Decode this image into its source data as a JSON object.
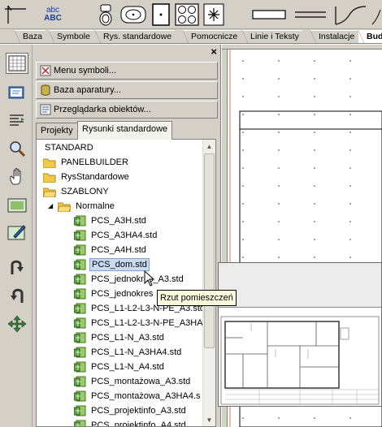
{
  "toolbar": {
    "tools": [
      {
        "icon": "cursor-icon"
      },
      {
        "icon": "text-abc-icon",
        "label_top": "abc",
        "label_bottom": "ABC"
      },
      {
        "icon": "toilet-icon"
      },
      {
        "icon": "sink-icon"
      },
      {
        "icon": "door-symbol-icon"
      },
      {
        "icon": "stove-icon"
      },
      {
        "icon": "asterisk-icon"
      },
      {
        "icon": "rectangle-icon"
      },
      {
        "icon": "parallel-lines-icon"
      },
      {
        "icon": "curve-icon"
      }
    ]
  },
  "tabs": [
    {
      "label": "Baza"
    },
    {
      "label": "Symbole"
    },
    {
      "label": "Rys. standardowe"
    },
    {
      "label": "Pomocnicze"
    },
    {
      "label": "Linie i Teksty"
    },
    {
      "label": "Instalacje"
    },
    {
      "label": "Bud"
    }
  ],
  "left_tools": [
    {
      "icon": "grid-view-icon"
    },
    {
      "icon": "book-icon"
    },
    {
      "icon": "list-align-icon"
    },
    {
      "icon": "zoom-icon"
    },
    {
      "icon": "pan-hand-icon"
    },
    {
      "icon": "zoom-window-icon"
    },
    {
      "icon": "edit-window-icon"
    },
    {
      "icon": "redo-icon"
    },
    {
      "icon": "undo-icon"
    },
    {
      "icon": "move-icon"
    }
  ],
  "panel": {
    "close": "×",
    "buttons": [
      {
        "label": "Menu symboli...",
        "icon": "symbol-menu-icon"
      },
      {
        "label": "Baza aparatury...",
        "icon": "database-icon"
      },
      {
        "label": "Przeglądarka obiektów...",
        "icon": "object-browser-icon"
      }
    ],
    "tabs": [
      {
        "label": "Projekty",
        "active": false
      },
      {
        "label": "Rysunki standardowe",
        "active": true
      }
    ]
  },
  "tree": {
    "root": "STANDARD",
    "folders": [
      "PANELBUILDER",
      "RysStandardowe",
      "SZABLONY"
    ],
    "subfolder": "Normalne",
    "files": [
      "PCS_A3H.std",
      "PCS_A3HA4.std",
      "PCS_A4H.std",
      "PCS_dom.std",
      "PCS_jednokres_A3.std",
      "PCS_jednokres",
      "PCS_L1-L2-L3-N-PE_A3.std",
      "PCS_L1-L2-L3-N-PE_A3HA",
      "PCS_L1-N_A3.std",
      "PCS_L1-N_A3HA4.std",
      "PCS_L1-N_A4.std",
      "PCS_montażowa_A3.std",
      "PCS_montażowa_A3HA4.s",
      "PCS_projektinfo_A3.std",
      "PCS_projektinfo_A4.std"
    ],
    "selected_index": 3
  },
  "tooltip": {
    "text": "Rzut pomieszczeń"
  }
}
